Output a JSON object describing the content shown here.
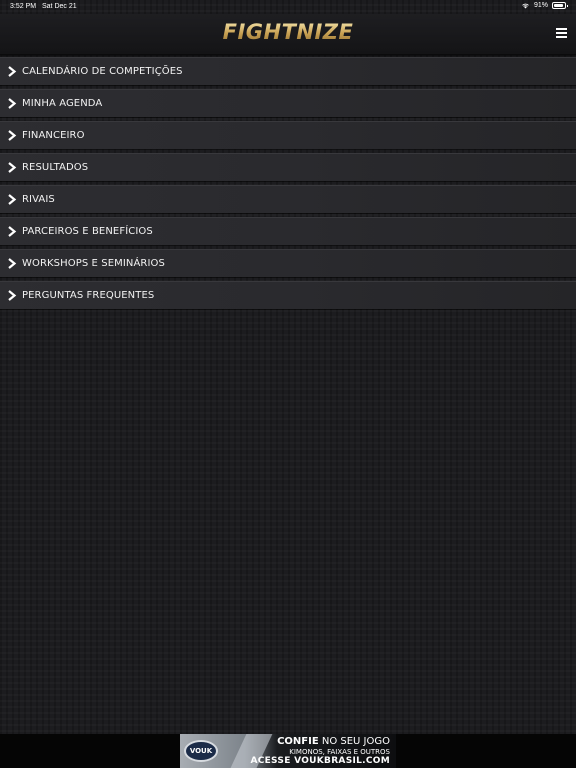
{
  "status_bar": {
    "time": "3:52 PM",
    "date": "Sat Dec 21",
    "battery": "91%",
    "battery_level": 0.91,
    "wifi_icon": "wifi-icon",
    "battery_icon": "battery-icon"
  },
  "header": {
    "logo": "FIGHTNIZE",
    "menu_icon": "hamburger-menu-icon",
    "accent_color": "#d6b264"
  },
  "menu": {
    "items": [
      {
        "label": "CALENDÁRIO DE COMPETIÇÕES",
        "icon": "chevron-right-icon"
      },
      {
        "label": "MINHA AGENDA",
        "icon": "chevron-right-icon"
      },
      {
        "label": "FINANCEIRO",
        "icon": "chevron-right-icon"
      },
      {
        "label": "RESULTADOS",
        "icon": "chevron-right-icon"
      },
      {
        "label": "RIVAIS",
        "icon": "chevron-right-icon"
      },
      {
        "label": "PARCEIROS E BENEFÍCIOS",
        "icon": "chevron-right-icon"
      },
      {
        "label": "WORKSHOPS E SEMINÁRIOS",
        "icon": "chevron-right-icon"
      },
      {
        "label": "PERGUNTAS FREQUENTES",
        "icon": "chevron-right-icon"
      }
    ]
  },
  "ad": {
    "brand": "VOUK",
    "headline_bold": "CONFIE",
    "headline_rest": " NO SEU JOGO",
    "subline": "KIMONOS, FAIXAS E OUTROS",
    "cta": "ACESSE VOUKBRASIL.COM"
  }
}
